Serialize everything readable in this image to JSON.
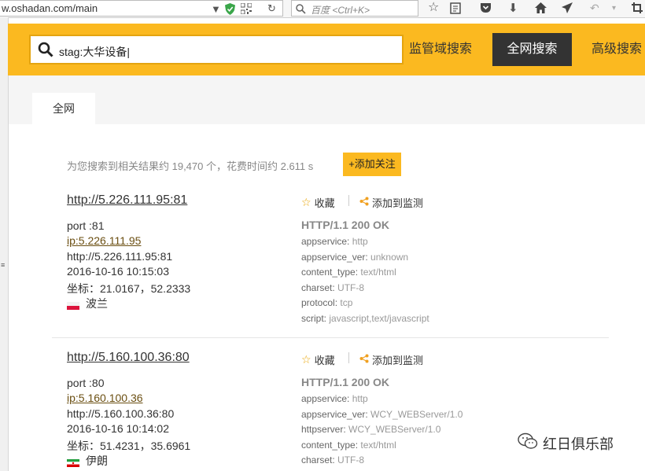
{
  "browser": {
    "url": "w.oshadan.com/main",
    "search_placeholder": "百度 <Ctrl+K>"
  },
  "header": {
    "query": "stag:大华设备|",
    "region_search_label": "监管域搜索",
    "all_search_label": "全网搜索",
    "advanced_search_label": "高级搜索",
    "accent_color": "#fbb920"
  },
  "tabs": [
    {
      "label": "全网"
    }
  ],
  "summary": {
    "text": "为您搜索到相关结果约 19,470 个，花费时间约 2.611 s",
    "follow_label": "+添加关注"
  },
  "result_actions": {
    "favorite_label": "收藏",
    "monitor_label": "添加到监测"
  },
  "results": [
    {
      "title": "http://5.226.111.95:81",
      "port": "port :81",
      "ip": "ip:5.226.111.95",
      "url": "http://5.226.111.95:81",
      "time": "2016-10-16 10:15:03",
      "coords": "坐标：21.0167，52.2333",
      "country": "波兰",
      "http_status": "HTTP/1.1 200 OK",
      "headers": [
        {
          "key": "appservice:",
          "value": " http"
        },
        {
          "key": "appservice_ver:",
          "value": " unknown"
        },
        {
          "key": "content_type:",
          "value": " text/html"
        },
        {
          "key": "charset:",
          "value": " UTF-8"
        },
        {
          "key": "protocol:",
          "value": " tcp"
        },
        {
          "key": "script:",
          "value": " javascript,text/javascript"
        }
      ]
    },
    {
      "title": "http://5.160.100.36:80",
      "port": "port :80",
      "ip": "ip:5.160.100.36",
      "url": "http://5.160.100.36:80",
      "time": "2016-10-16 10:14:02",
      "coords": "坐标：51.4231，35.6961",
      "country": "伊朗",
      "http_status": "HTTP/1.1 200 OK",
      "headers": [
        {
          "key": "appservice:",
          "value": " http"
        },
        {
          "key": "appservice_ver:",
          "value": " WCY_WEBServer/1.0"
        },
        {
          "key": "httpserver:",
          "value": " WCY_WEBServer/1.0"
        },
        {
          "key": "content_type:",
          "value": " text/html"
        },
        {
          "key": "charset:",
          "value": " UTF-8"
        }
      ]
    }
  ],
  "watermark": "红日俱乐部"
}
